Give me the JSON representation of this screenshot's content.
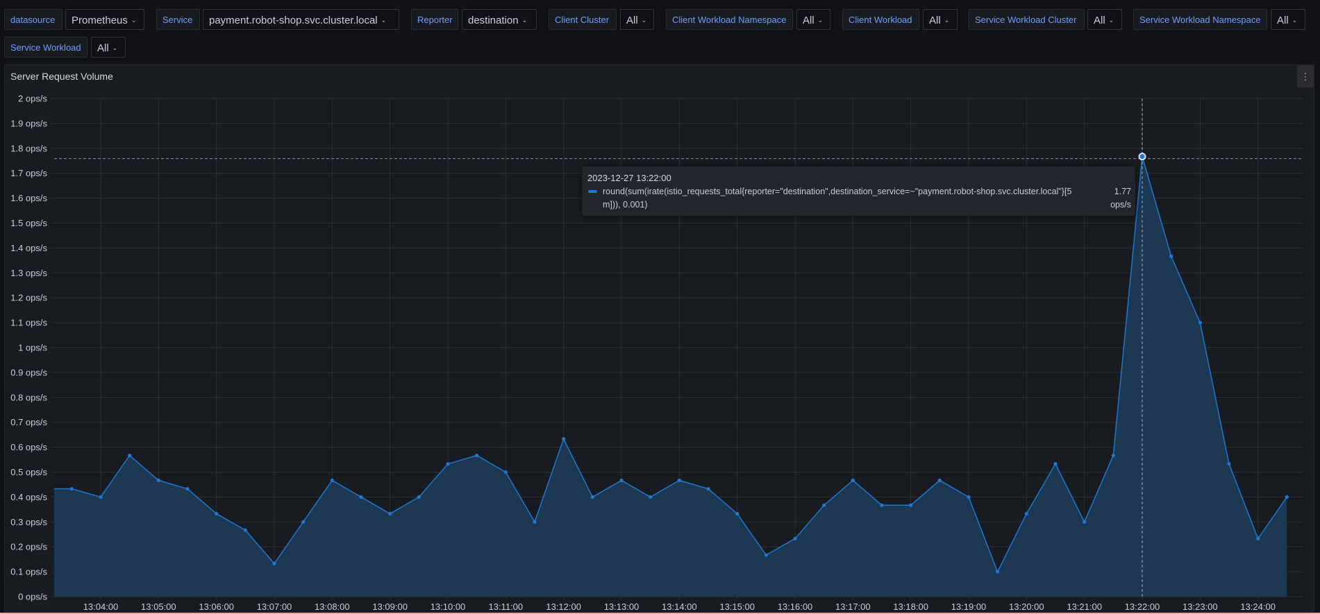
{
  "variables": [
    {
      "label": "datasource",
      "value": "Prometheus"
    },
    {
      "label": "Service",
      "value": "payment.robot-shop.svc.cluster.local"
    },
    {
      "label": "Reporter",
      "value": "destination"
    },
    {
      "label": "Client Cluster",
      "value": "All"
    },
    {
      "label": "Client Workload Namespace",
      "value": "All"
    },
    {
      "label": "Client Workload",
      "value": "All"
    },
    {
      "label": "Service Workload Cluster",
      "value": "All"
    },
    {
      "label": "Service Workload Namespace",
      "value": "All"
    },
    {
      "label": "Service Workload",
      "value": "All"
    }
  ],
  "panel": {
    "title": "Server Request Volume",
    "menu_icon": "vertical-ellipsis-icon",
    "menu_glyph": "⋮"
  },
  "colors": {
    "series": "#1f78d1",
    "series_fill": "#1c3a55",
    "grid": "#2c2f35",
    "bottom_strip": "#e8a492"
  },
  "tooltip": {
    "time": "2023-12-27 13:22:00",
    "series_name": "round(sum(irate(istio_requests_total{reporter=\"destination\",destination_service=~\"payment.robot-shop.svc.cluster.local\"}[5m])), 0.001)",
    "value": "1.77",
    "unit": "ops/s"
  },
  "chart_data": {
    "type": "area",
    "title": "Server Request Volume",
    "xlabel": "",
    "ylabel": "",
    "unit": "ops/s",
    "ylim": [
      0,
      2
    ],
    "yticks": [
      0,
      0.1,
      0.2,
      0.3,
      0.4,
      0.5,
      0.6,
      0.7,
      0.8,
      0.9,
      1,
      1.1,
      1.2,
      1.3,
      1.4,
      1.5,
      1.6,
      1.7,
      1.8,
      1.9,
      2
    ],
    "ytick_labels": [
      "0 ops/s",
      "0.1 ops/s",
      "0.2 ops/s",
      "0.3 ops/s",
      "0.4 ops/s",
      "0.5 ops/s",
      "0.6 ops/s",
      "0.7 ops/s",
      "0.8 ops/s",
      "0.9 ops/s",
      "1 ops/s",
      "1.1 ops/s",
      "1.2 ops/s",
      "1.3 ops/s",
      "1.4 ops/s",
      "1.5 ops/s",
      "1.6 ops/s",
      "1.7 ops/s",
      "1.8 ops/s",
      "1.9 ops/s",
      "2 ops/s"
    ],
    "xlim": [
      "13:03:02",
      "13:25:00"
    ],
    "xticks": [
      "13:04:00",
      "13:05:00",
      "13:06:00",
      "13:07:00",
      "13:08:00",
      "13:09:00",
      "13:10:00",
      "13:11:00",
      "13:12:00",
      "13:13:00",
      "13:14:00",
      "13:15:00",
      "13:16:00",
      "13:17:00",
      "13:18:00",
      "13:19:00",
      "13:20:00",
      "13:21:00",
      "13:22:00",
      "13:23:00",
      "13:24:00"
    ],
    "grid": true,
    "legend": "none",
    "hover": {
      "x": "13:22:00",
      "y": 1.767
    },
    "series": [
      {
        "name": "round(sum(irate(istio_requests_total{reporter=\"destination\",destination_service=~\"payment.robot-shop.svc.cluster.local\"}[5m])), 0.001)",
        "x": [
          "13:03:02",
          "13:03:30",
          "13:04:00",
          "13:04:30",
          "13:05:00",
          "13:05:30",
          "13:06:00",
          "13:06:30",
          "13:07:00",
          "13:07:30",
          "13:08:00",
          "13:08:30",
          "13:09:00",
          "13:09:30",
          "13:10:00",
          "13:10:30",
          "13:11:00",
          "13:11:30",
          "13:12:00",
          "13:12:30",
          "13:13:00",
          "13:13:30",
          "13:14:00",
          "13:14:30",
          "13:15:00",
          "13:15:30",
          "13:16:00",
          "13:16:30",
          "13:17:00",
          "13:17:30",
          "13:18:00",
          "13:18:30",
          "13:19:00",
          "13:19:30",
          "13:20:00",
          "13:20:30",
          "13:21:00",
          "13:21:30",
          "13:22:00",
          "13:22:30",
          "13:23:00",
          "13:23:30",
          "13:24:00",
          "13:24:30"
        ],
        "values": [
          0.433,
          0.433,
          0.4,
          0.567,
          0.467,
          0.433,
          0.333,
          0.267,
          0.133,
          0.3,
          0.467,
          0.4,
          0.333,
          0.4,
          0.533,
          0.567,
          0.5,
          0.3,
          0.633,
          0.4,
          0.467,
          0.4,
          0.467,
          0.433,
          0.333,
          0.167,
          0.233,
          0.367,
          0.467,
          0.367,
          0.367,
          0.467,
          0.4,
          0.1,
          0.333,
          0.533,
          0.3,
          0.567,
          1.767,
          1.367,
          1.1,
          0.533,
          0.233,
          0.4
        ],
        "markers_from_index": 1
      }
    ]
  }
}
